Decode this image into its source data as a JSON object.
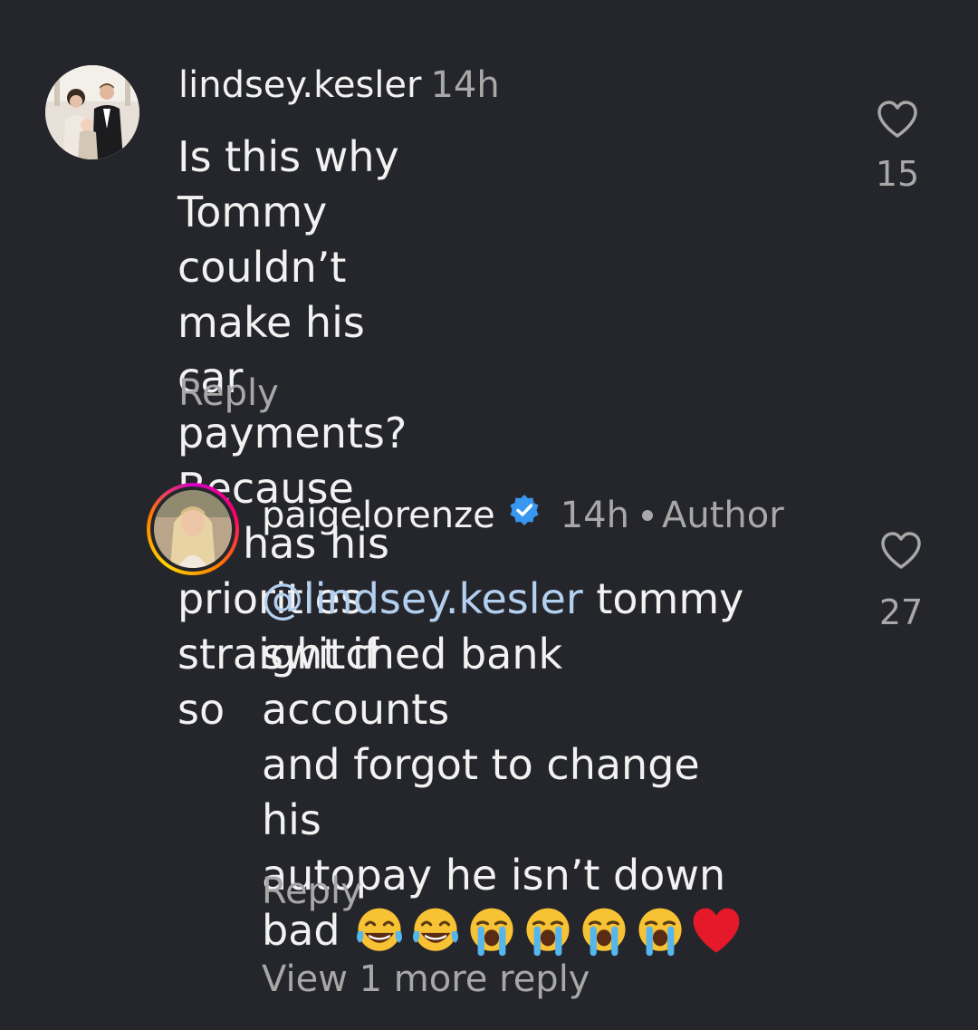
{
  "comments": [
    {
      "username": "lindsey.kesler",
      "time": "14h",
      "text_lines": [
        "Is this why Tommy couldn’t",
        "make his car payments?",
        "Because he has his priorities",
        "straight if so"
      ],
      "reply_label": "Reply",
      "like_count": "15"
    },
    {
      "username": "paigelorenze",
      "verified": true,
      "time": "14h",
      "author_label": "Author",
      "mention": "@lindsey.kesler",
      "text_first_rest": " tommy",
      "text_lines": [
        "switched bank accounts",
        "and forgot to change his",
        "autopay he isn’t down"
      ],
      "last_line_text": "bad ",
      "emojis": [
        "joy",
        "joy",
        "sob",
        "sob",
        "sob",
        "sob",
        "red-heart"
      ],
      "reply_label": "Reply",
      "like_count": "27"
    }
  ],
  "view_more_replies": "View 1 more reply",
  "colors": {
    "background": "#25262b",
    "text": "#f2f2f2",
    "secondary": "#a8a8a8",
    "mention": "#b3d0f0",
    "verified": "#3897f0"
  }
}
